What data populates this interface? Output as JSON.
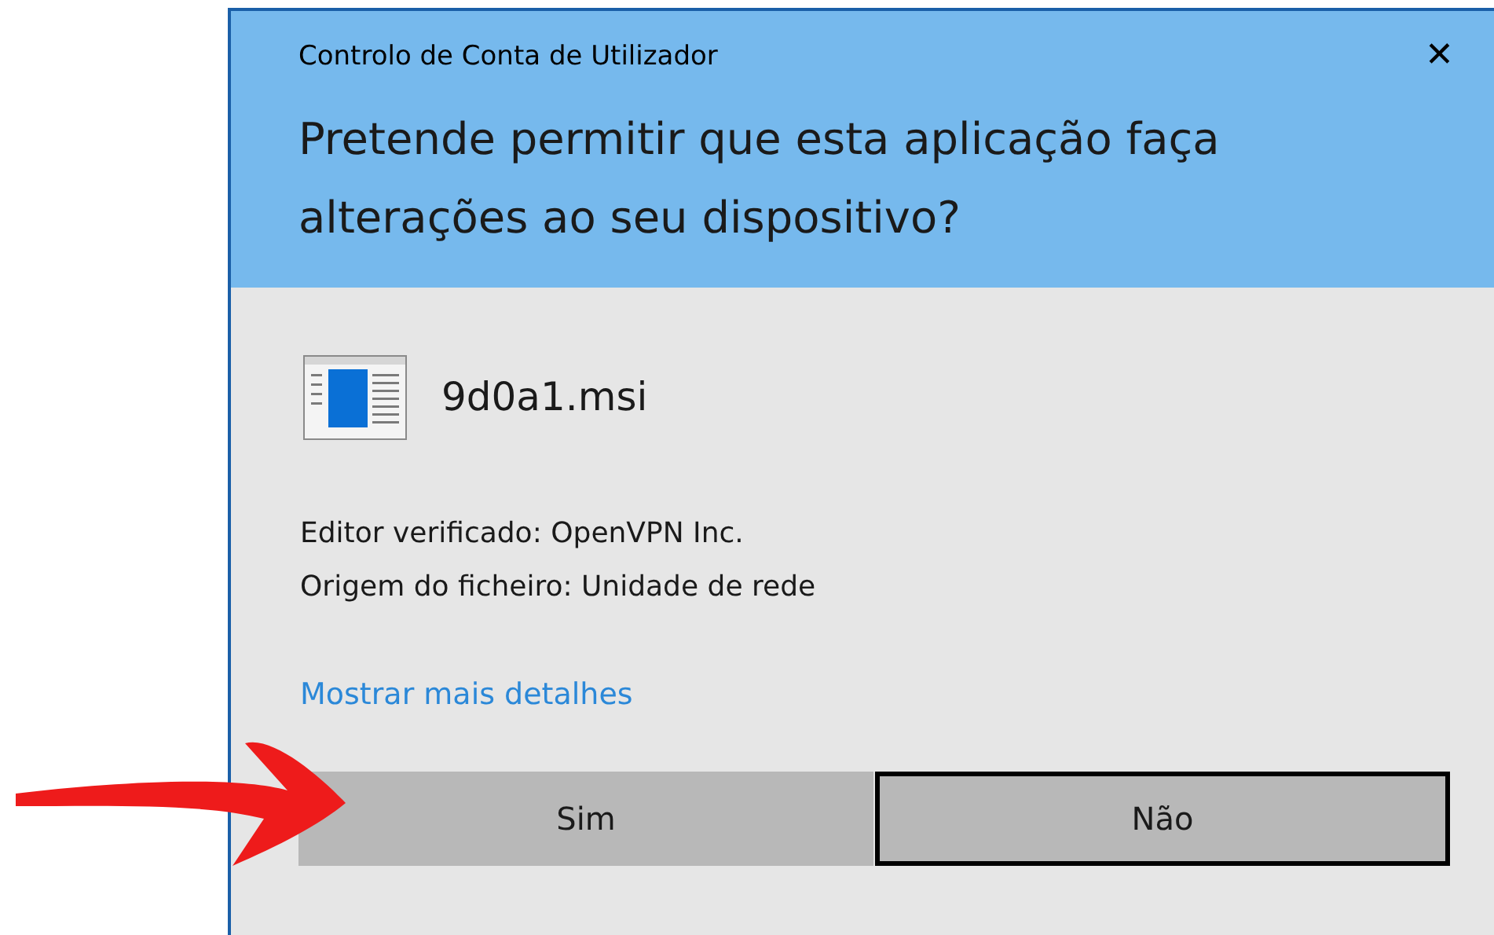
{
  "window": {
    "title": "Controlo de Conta de Utilizador",
    "close": "✕"
  },
  "heading": "Pretende permitir que esta aplicação faça alterações ao seu dispositivo?",
  "program": {
    "name": "9d0a1.msi"
  },
  "details": [
    "Editor verificado: OpenVPN Inc.",
    "Origem do ficheiro: Unidade de rede"
  ],
  "link": "Mostrar mais detalhes",
  "buttons": [
    {
      "label": "Sim",
      "focused": false
    },
    {
      "label": "Não",
      "focused": true
    }
  ]
}
